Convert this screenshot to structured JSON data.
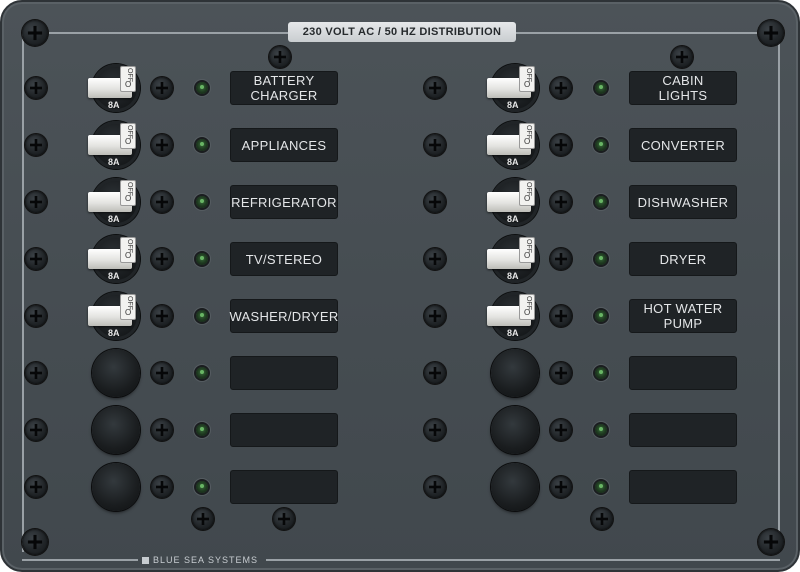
{
  "panel": {
    "title": "230 VOLT AC / 50 HZ DISTRIBUTION",
    "brand": "BLUE SEA SYSTEMS",
    "colors": {
      "panel": "#464d52",
      "label": "#1f2326",
      "led": "#6fbf6a",
      "rocker": "#e8e8e5"
    }
  },
  "breaker_off_text": "OFF",
  "breaker_o_text": "O",
  "left_column": [
    {
      "label": "BATTERY\nCHARGER",
      "amps": "8A"
    },
    {
      "label": "APPLIANCES",
      "amps": "8A"
    },
    {
      "label": "REFRIGERATOR",
      "amps": "8A"
    },
    {
      "label": "TV/STEREO",
      "amps": "8A"
    },
    {
      "label": "WASHER/DRYER",
      "amps": "8A"
    },
    {
      "label": "",
      "amps": ""
    },
    {
      "label": "",
      "amps": ""
    },
    {
      "label": "",
      "amps": ""
    }
  ],
  "right_column": [
    {
      "label": "CABIN\nLIGHTS",
      "amps": "8A"
    },
    {
      "label": "CONVERTER",
      "amps": "8A"
    },
    {
      "label": "DISHWASHER",
      "amps": "8A"
    },
    {
      "label": "DRYER",
      "amps": "8A"
    },
    {
      "label": "HOT WATER\nPUMP",
      "amps": "8A"
    },
    {
      "label": "",
      "amps": ""
    },
    {
      "label": "",
      "amps": ""
    },
    {
      "label": "",
      "amps": ""
    }
  ]
}
